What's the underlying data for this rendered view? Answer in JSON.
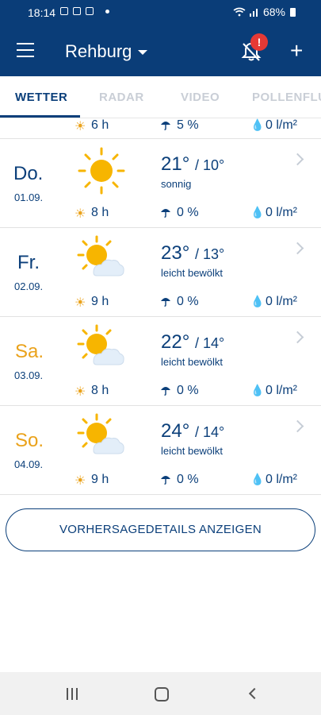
{
  "status": {
    "time": "18:14",
    "battery": "68%"
  },
  "header": {
    "city": "Rehburg",
    "alert_badge": "!"
  },
  "tabs": [
    {
      "label": "WETTER",
      "active": true
    },
    {
      "label": "RADAR",
      "active": false
    },
    {
      "label": "VIDEO",
      "active": false
    },
    {
      "label": "POLLENFLU",
      "active": false
    }
  ],
  "top_partial_row": {
    "sun": "6 h",
    "rain": "5 %",
    "amount": "0 l/m²"
  },
  "days": [
    {
      "name": "Do.",
      "date": "01.09.",
      "high": "21°",
      "low": "/ 10°",
      "desc": "sonnig",
      "icon": "sun-icon",
      "sun": "8 h",
      "rain": "0 %",
      "amount": "0 l/m²",
      "weekend": false
    },
    {
      "name": "Fr.",
      "date": "02.09.",
      "high": "23°",
      "low": "/ 13°",
      "desc": "leicht bewölkt",
      "icon": "partly-cloudy-icon",
      "sun": "9 h",
      "rain": "0 %",
      "amount": "0 l/m²",
      "weekend": false
    },
    {
      "name": "Sa.",
      "date": "03.09.",
      "high": "22°",
      "low": "/ 14°",
      "desc": "leicht bewölkt",
      "icon": "partly-cloudy-icon",
      "sun": "8 h",
      "rain": "0 %",
      "amount": "0 l/m²",
      "weekend": true
    },
    {
      "name": "So.",
      "date": "04.09.",
      "high": "24°",
      "low": "/ 14°",
      "desc": "leicht bewölkt",
      "icon": "partly-cloudy-icon",
      "sun": "9 h",
      "rain": "0 %",
      "amount": "0 l/m²",
      "weekend": true
    }
  ],
  "details_button": "VORHERSAGEDETAILS ANZEIGEN",
  "colors": {
    "primary": "#0a3d78",
    "weekend": "#eaa21b",
    "sun": "#f7b500",
    "alert": "#e53935"
  }
}
